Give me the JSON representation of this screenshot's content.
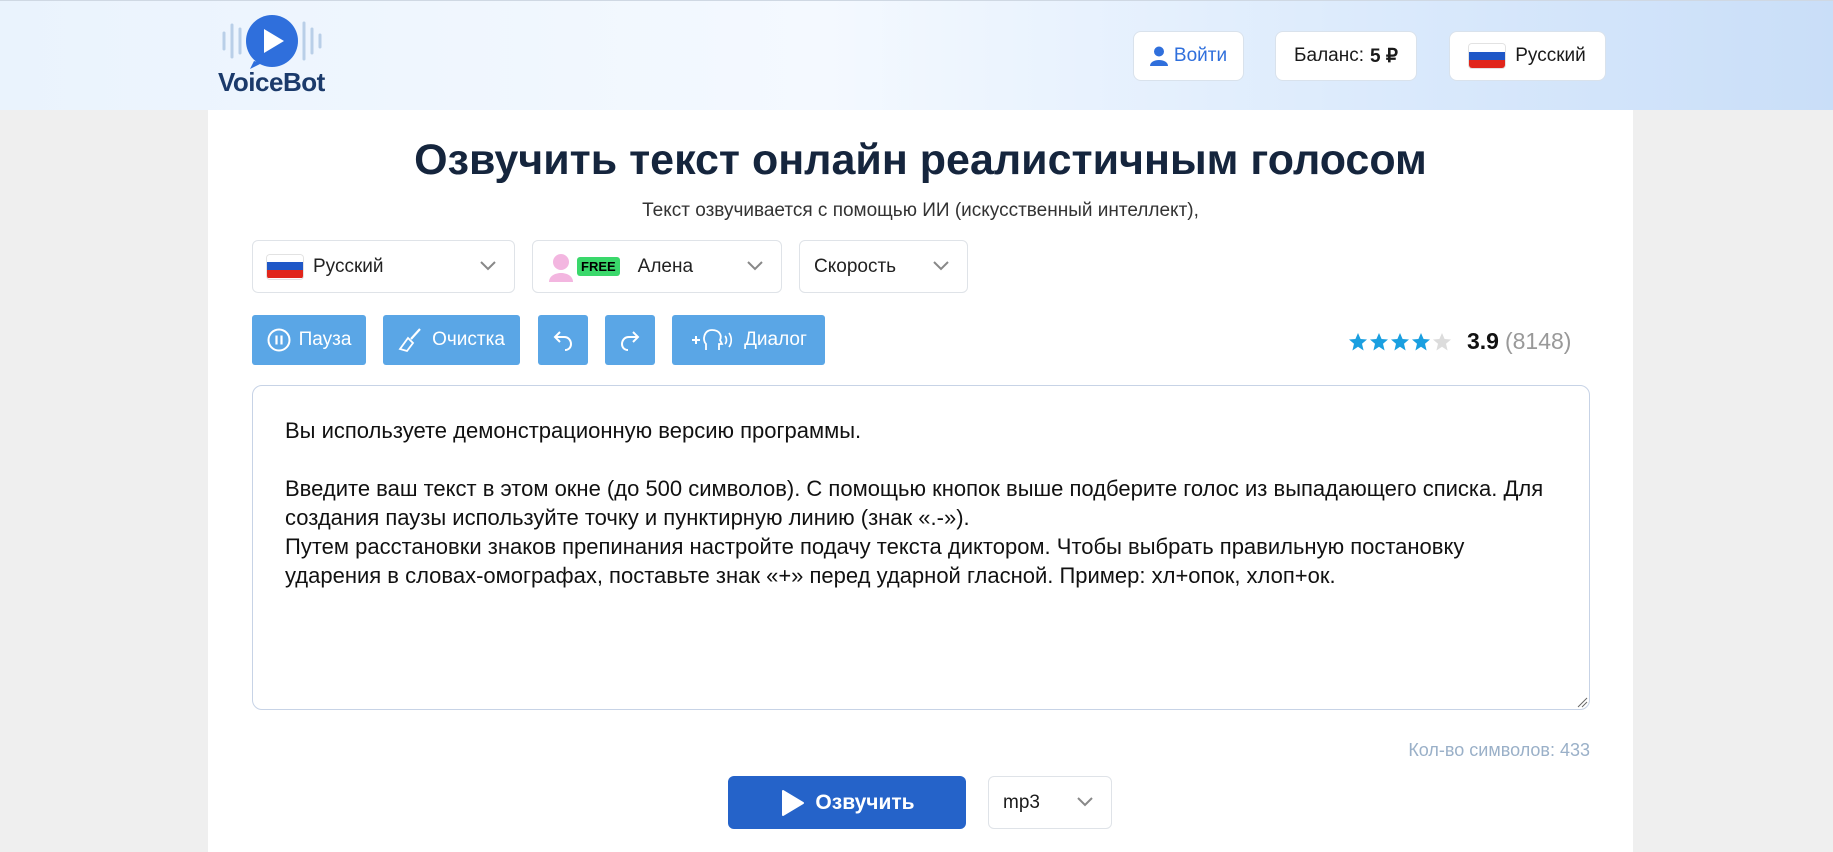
{
  "header": {
    "logo_text": "VoiceBot",
    "login_label": "Войти",
    "balance_label": "Баланс:",
    "balance_value": "5 ₽",
    "language_label": "Русский"
  },
  "main": {
    "title": "Озвучить текст онлайн реалистичным голосом",
    "subtitle": "Текст озвучивается с помощью ИИ (искусственный интеллект),",
    "selectors": {
      "language": "Русский",
      "voice_badge": "FREE",
      "voice": "Алена",
      "speed": "Скорость"
    },
    "toolbar": {
      "pause": "Пауза",
      "clear": "Очистка",
      "dialog": "Диалог"
    },
    "rating": {
      "value": "3.9",
      "count": "(8148)",
      "stars_filled": 4,
      "stars_total": 5
    },
    "text": "Вы используете демонстрационную версию программы.\n\nВведите ваш текст в этом окне (до 500 символов). С помощью кнопок выше подберите голос из выпадающего списка. Для создания паузы используйте точку и пунктирную линию (знак «.-»).\nПутем расстановки знаков препинания настройте подачу текста диктором. Чтобы выбрать правильную постановку ударения в словах-омографах, поставьте знак «+» перед ударной гласной. Пример: хл+опок, хлоп+ок.",
    "char_count": "Кол-во символов: 433",
    "speak_label": "Озвучить",
    "format": "mp3"
  },
  "colors": {
    "accent": "#2563c9",
    "toolbar": "#5aa6e6",
    "star": "#1a9fe0",
    "title": "#15253d"
  }
}
